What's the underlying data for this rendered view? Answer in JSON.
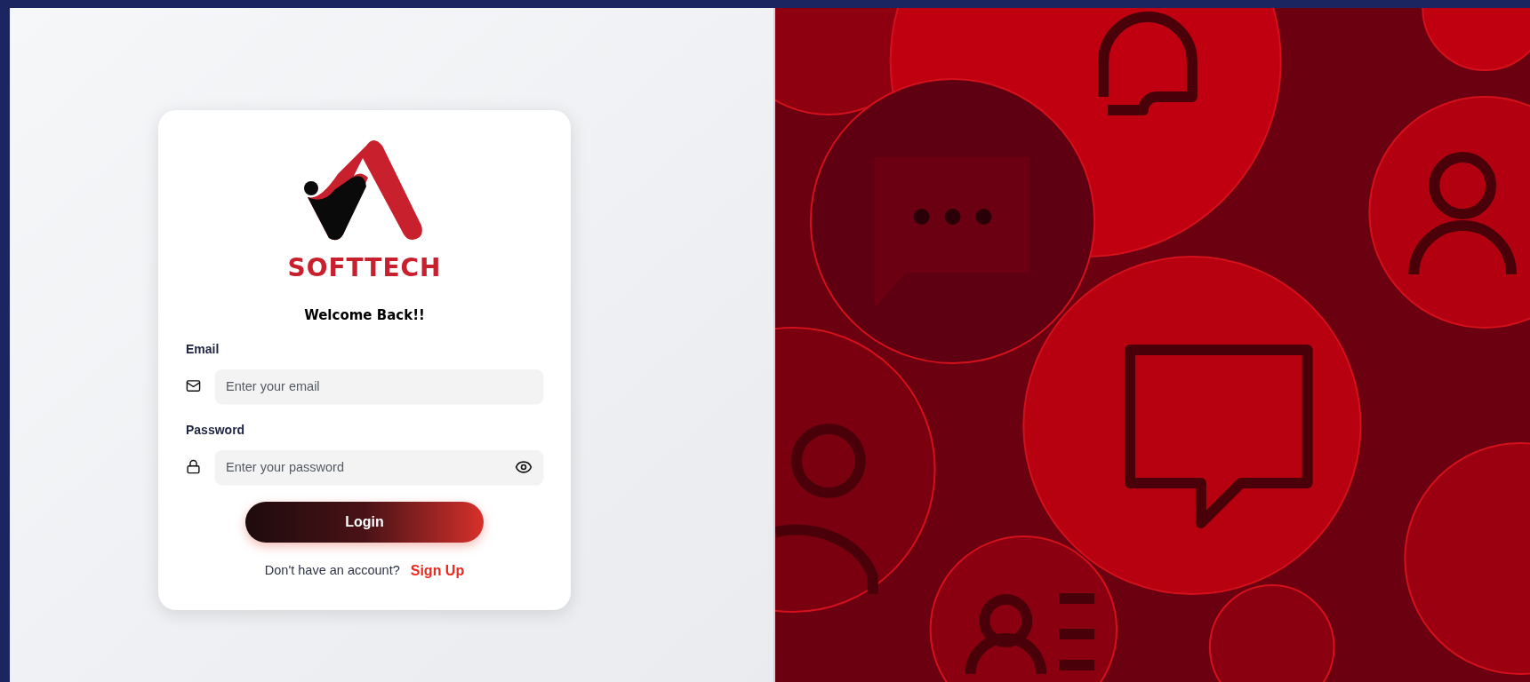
{
  "brand": {
    "name": "SOFTTECH"
  },
  "heading": "Welcome Back!!",
  "fields": [
    {
      "kind": "email",
      "label": "Email",
      "placeholder": "Enter your email"
    },
    {
      "kind": "password",
      "label": "Password",
      "placeholder": "Enter your password"
    }
  ],
  "login_button": "Login",
  "signup": {
    "prompt": "Don't have an account?",
    "link": "Sign Up"
  }
}
